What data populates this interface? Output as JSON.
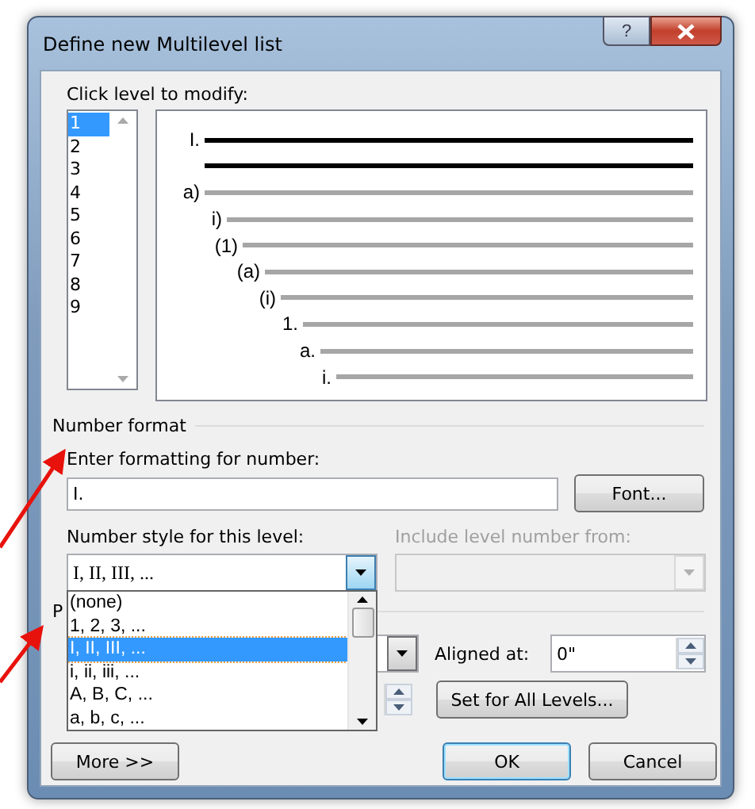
{
  "window": {
    "title": "Define new Multilevel list",
    "help": "?"
  },
  "levels": {
    "label": "Click level to modify:",
    "items": [
      {
        "label": "1",
        "selected": true
      },
      {
        "label": "2",
        "selected": false
      },
      {
        "label": "3",
        "selected": false
      },
      {
        "label": "4",
        "selected": false
      },
      {
        "label": "5",
        "selected": false
      },
      {
        "label": "6",
        "selected": false
      },
      {
        "label": "7",
        "selected": false
      },
      {
        "label": "8",
        "selected": false
      },
      {
        "label": "9",
        "selected": false
      }
    ]
  },
  "preview": [
    {
      "label": "I."
    },
    {
      "label": "a)"
    },
    {
      "label": "i)"
    },
    {
      "label": "(1)"
    },
    {
      "label": "(a)"
    },
    {
      "label": "(i)"
    },
    {
      "label": "1."
    },
    {
      "label": "a."
    },
    {
      "label": "i."
    }
  ],
  "number_format": {
    "heading": "Number format",
    "format_label": "Enter formatting for number:",
    "format_value": "I.",
    "font_button": "Font...",
    "style_label": "Number style for this level:",
    "style_value": "I, II, III, ...",
    "include_label": "Include level number from:",
    "include_disabled": true,
    "style_options": [
      {
        "label": "(none)",
        "selected": false
      },
      {
        "label": "1, 2, 3, ...",
        "selected": false
      },
      {
        "label": "I, II, III, ...",
        "selected": true
      },
      {
        "label": "i, ii, iii, ...",
        "selected": false
      },
      {
        "label": "A, B, C, ...",
        "selected": false
      },
      {
        "label": "a, b, c, ...",
        "selected": false
      }
    ]
  },
  "position": {
    "heading": "P",
    "aligned_label": "Aligned at:",
    "aligned_value": "0\"",
    "set_all_button": "Set for All Levels..."
  },
  "buttons": [
    {
      "label": "More >>",
      "default": false
    },
    {
      "label": "OK",
      "default": true
    },
    {
      "label": "Cancel",
      "default": false
    }
  ]
}
